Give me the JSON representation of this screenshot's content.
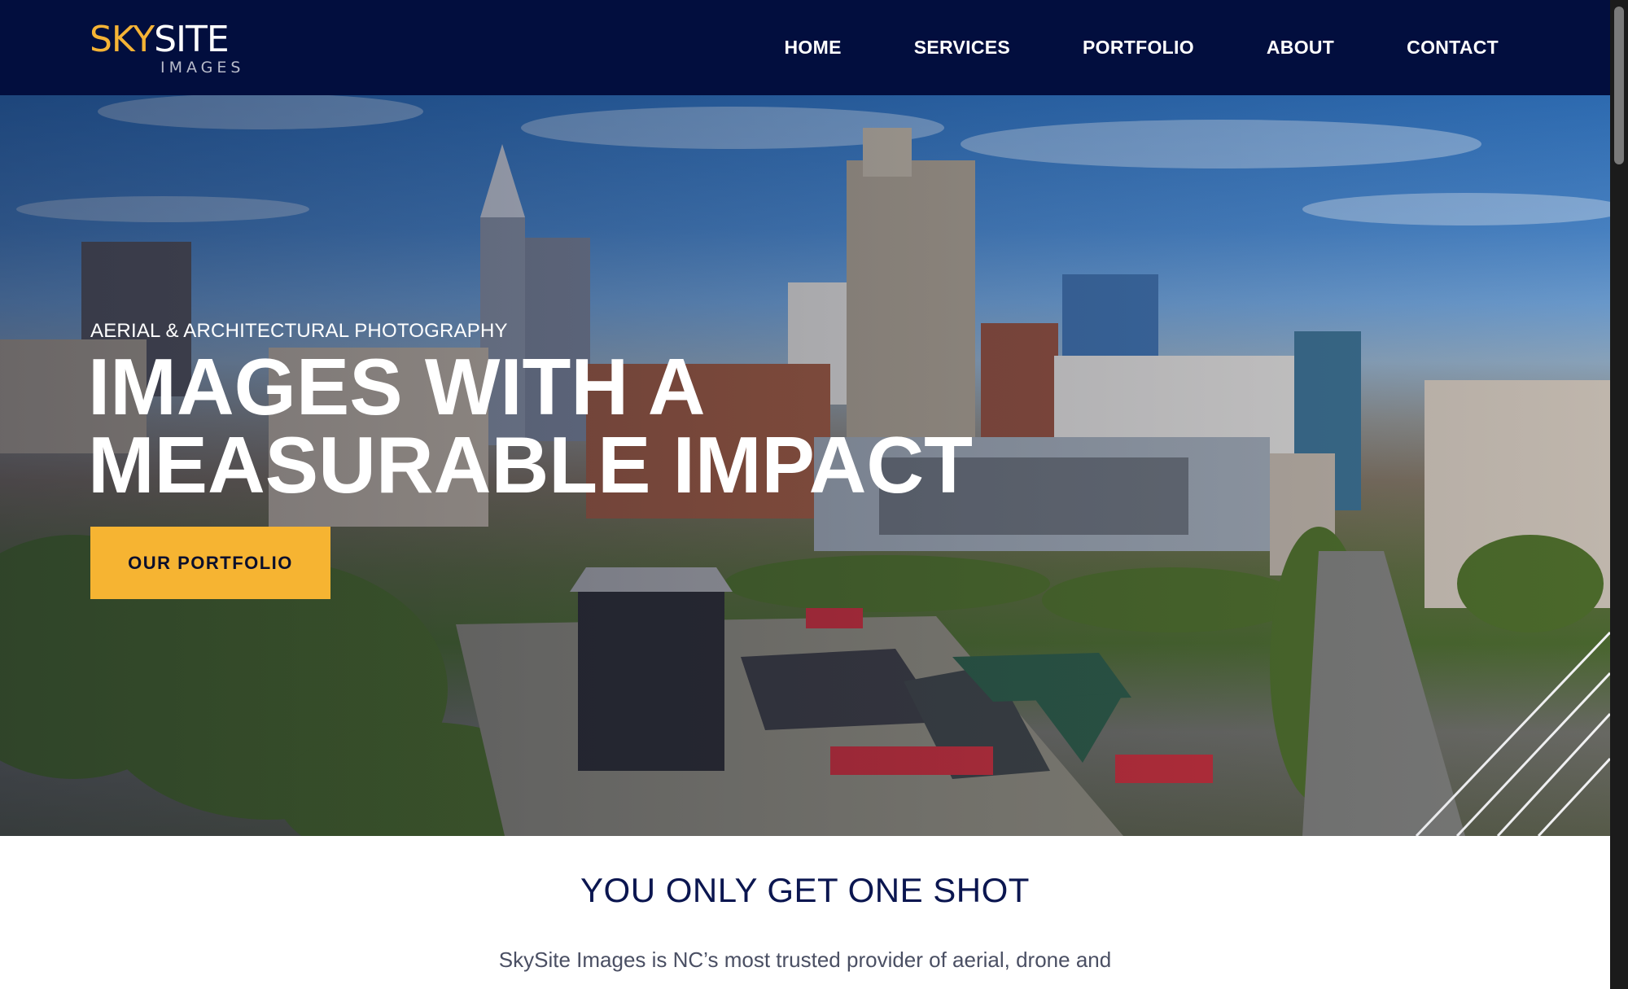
{
  "logo": {
    "sky": "SKY",
    "site": "SITE",
    "sub": "IMAGES",
    "colors": {
      "sky": "#f5b335",
      "site": "#ffffff"
    }
  },
  "nav": {
    "items": [
      {
        "label": "HOME"
      },
      {
        "label": "SERVICES"
      },
      {
        "label": "PORTFOLIO"
      },
      {
        "label": "ABOUT"
      },
      {
        "label": "CONTACT"
      }
    ]
  },
  "hero": {
    "eyebrow": "AERIAL & ARCHITECTURAL PHOTOGRAPHY",
    "title_line1": "IMAGES WITH A",
    "title_line2": "MEASURABLE IMPACT",
    "cta_label": "OUR PORTFOLIO",
    "background_image": "aerial-city-skyline-amphitheater"
  },
  "intro": {
    "title": "YOU ONLY GET ONE SHOT",
    "text": "SkySite Images is NC’s most trusted provider of aerial, drone and"
  },
  "colors": {
    "header_bg": "#020e3e",
    "accent": "#f6b432",
    "heading_navy": "#0b1650"
  }
}
